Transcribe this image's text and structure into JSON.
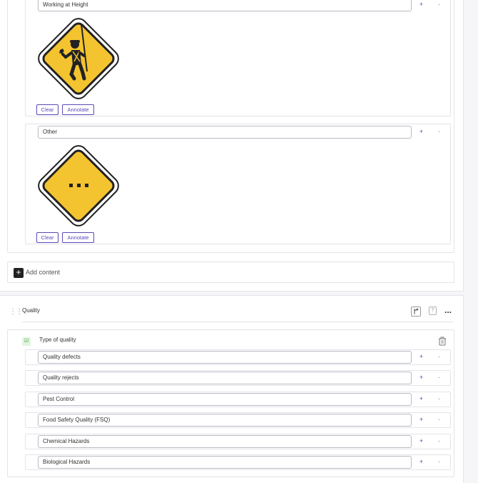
{
  "top_section": {
    "items": [
      {
        "value": "Working at Height",
        "plus": "+",
        "minus": "-",
        "image": "worker-at-height-warning-sign",
        "clear": "Clear",
        "annotate": "Annotate"
      },
      {
        "value": "Other",
        "plus": "+",
        "minus": "-",
        "image": "other-ellipsis-warning-sign",
        "clear": "Clear",
        "annotate": "Annotate"
      }
    ],
    "add_content": {
      "icon": "+",
      "label": "Add content"
    }
  },
  "quality_section": {
    "title": "Quality",
    "toolbar": {
      "branch_icon": "branch-icon",
      "help_icon": "?",
      "more_icon": "..."
    },
    "question": {
      "label": "Type of quality",
      "icon": "checklist-icon"
    },
    "options": [
      {
        "value": "Quality defects",
        "plus": "+",
        "minus": "-"
      },
      {
        "value": "Quality rejects",
        "plus": "+",
        "minus": "-"
      },
      {
        "value": "Pest Control",
        "plus": "+",
        "minus": "-"
      },
      {
        "value": "Food Safety Quality (FSQ)",
        "plus": "+",
        "minus": "-"
      },
      {
        "value": "Chemical Hazards",
        "plus": "+",
        "minus": "-"
      },
      {
        "value": "Biological Hazards",
        "plus": "+",
        "minus": "-"
      }
    ]
  },
  "colors": {
    "accent": "#5a4ab8",
    "sign_yellow": "#f4c430",
    "border": "#e4e4ea"
  }
}
